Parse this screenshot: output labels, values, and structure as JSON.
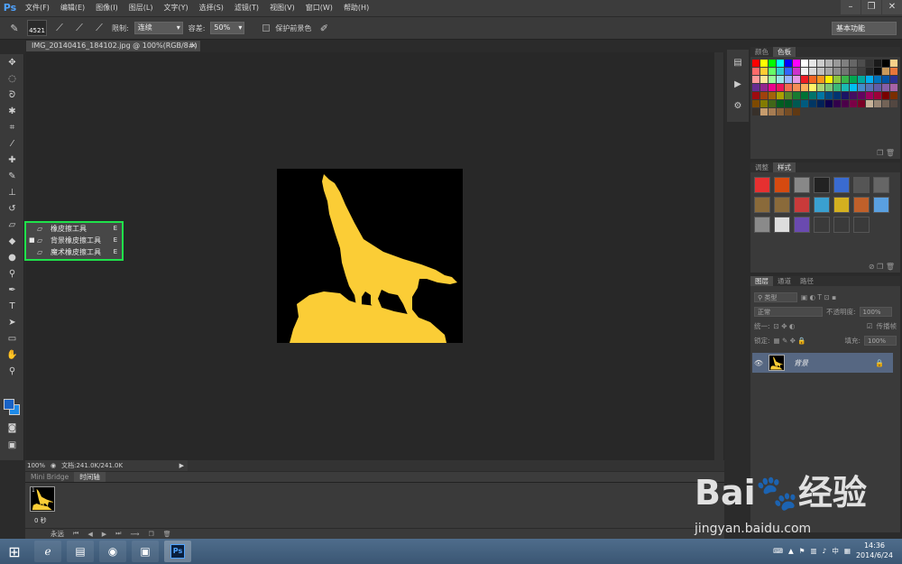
{
  "menubar": {
    "logo": "Ps",
    "items": [
      "文件(F)",
      "编辑(E)",
      "图像(I)",
      "图层(L)",
      "文字(Y)",
      "选择(S)",
      "滤镜(T)",
      "视图(V)",
      "窗口(W)",
      "帮助(H)"
    ]
  },
  "optionsbar": {
    "brush_size": "4521",
    "limit_label": "限制:",
    "limit_value": "连续",
    "tolerance_label": "容差:",
    "tolerance_value": "50%",
    "protect_fg_label": "保护前景色",
    "workspace": "基本功能"
  },
  "document": {
    "tab_title": "IMG_20140416_184102.jpg @ 100%(RGB/8#)",
    "close": "×"
  },
  "flyout": {
    "items": [
      {
        "label": "橡皮擦工具",
        "shortcut": "E",
        "active": false
      },
      {
        "label": "背景橡皮擦工具",
        "shortcut": "E",
        "active": true
      },
      {
        "label": "魔术橡皮擦工具",
        "shortcut": "E",
        "active": false
      }
    ]
  },
  "status": {
    "zoom": "100%",
    "doc": "文档:241.0K/241.0K"
  },
  "bottom_panel": {
    "tabs": [
      "Mini Bridge",
      "时间轴"
    ],
    "frame_number": "1",
    "frame_time": "0 秒",
    "loop": "永远"
  },
  "colors_panel": {
    "tabs": [
      "颜色",
      "色板"
    ]
  },
  "styles_panel": {
    "tabs": [
      "调整",
      "样式"
    ]
  },
  "layers_panel": {
    "tabs": [
      "图层",
      "通道",
      "路径"
    ],
    "filter_type": "类型",
    "blend_mode": "正常",
    "opacity_label": "不透明度:",
    "opacity_value": "100%",
    "unify_label": "统一:",
    "propagate_label": "传播帧",
    "lock_label": "锁定:",
    "fill_label": "填充:",
    "fill_value": "100%",
    "layer_name": "背景"
  },
  "taskbar": {
    "time": "14:36",
    "date": "2014/6/24",
    "ime": "中"
  },
  "watermark": {
    "brand": "Bai",
    "brand_cn": "经验",
    "url": "jingyan.baidu.com"
  },
  "swatch_colors": [
    "#ff0000",
    "#ffff00",
    "#00ff00",
    "#00ffff",
    "#0000ff",
    "#ff00ff",
    "#ffffff",
    "#e6e6e6",
    "#cccccc",
    "#b3b3b3",
    "#999999",
    "#808080",
    "#666666",
    "#4d4d4d",
    "#333333",
    "#1a1a1a",
    "#000000",
    "#f7d08a",
    "#ff6a6a",
    "#ffcc33",
    "#66ff66",
    "#33cccc",
    "#3366ff",
    "#cc33cc",
    "#f2f2f2",
    "#d9d9d9",
    "#bfbfbf",
    "#a6a6a6",
    "#8c8c8c",
    "#737373",
    "#595959",
    "#404040",
    "#262626",
    "#0d0d0d",
    "#c99a5b",
    "#e8763a",
    "#ff9999",
    "#ffe699",
    "#99ff99",
    "#99e6e6",
    "#99b3ff",
    "#e699e6",
    "#ed1c24",
    "#f26522",
    "#f7941d",
    "#fff200",
    "#8dc63f",
    "#39b54a",
    "#00a651",
    "#00a99d",
    "#00aeef",
    "#0072bc",
    "#0054a6",
    "#2e3192",
    "#662d91",
    "#92278f",
    "#ec008c",
    "#ed145b",
    "#f26c4f",
    "#f68e56",
    "#fbaf5d",
    "#fff568",
    "#acd373",
    "#7cc576",
    "#3bb878",
    "#1abbb4",
    "#00bff3",
    "#438ccb",
    "#5574b9",
    "#605ca8",
    "#855fa8",
    "#a763a8",
    "#9e0b0f",
    "#a0410d",
    "#a3620a",
    "#aba000",
    "#598527",
    "#197b30",
    "#007236",
    "#00746b",
    "#0076a3",
    "#004a80",
    "#003471",
    "#1b1464",
    "#440e62",
    "#630460",
    "#9e005d",
    "#9e0039",
    "#790000",
    "#7b2e00",
    "#7d4900",
    "#827b00",
    "#406618",
    "#005e20",
    "#005826",
    "#005952",
    "#005b7f",
    "#003663",
    "#002157",
    "#0d004c",
    "#32004b",
    "#4b0049",
    "#7b0046",
    "#7a0026",
    "#c7b299",
    "#998675",
    "#736357",
    "#534741",
    "#37302a",
    "#c69c6d",
    "#a67c52",
    "#8c6239",
    "#754c24",
    "#603913"
  ],
  "style_colors": [
    "#e63030",
    "#d64a10",
    "#888888",
    "#222222",
    "#3a6bd0",
    "#555555",
    "#666666",
    "#8a6a3a",
    "#8a6a3a",
    "#c93a3a",
    "#3aa0d0",
    "#d4b020",
    "#c0602a",
    "#5aa0e0",
    "#8a8a8a",
    "#dddddd",
    "#6a4ab0",
    "#3a3a3a",
    "#3a3a3a",
    "#3a3a3a"
  ]
}
